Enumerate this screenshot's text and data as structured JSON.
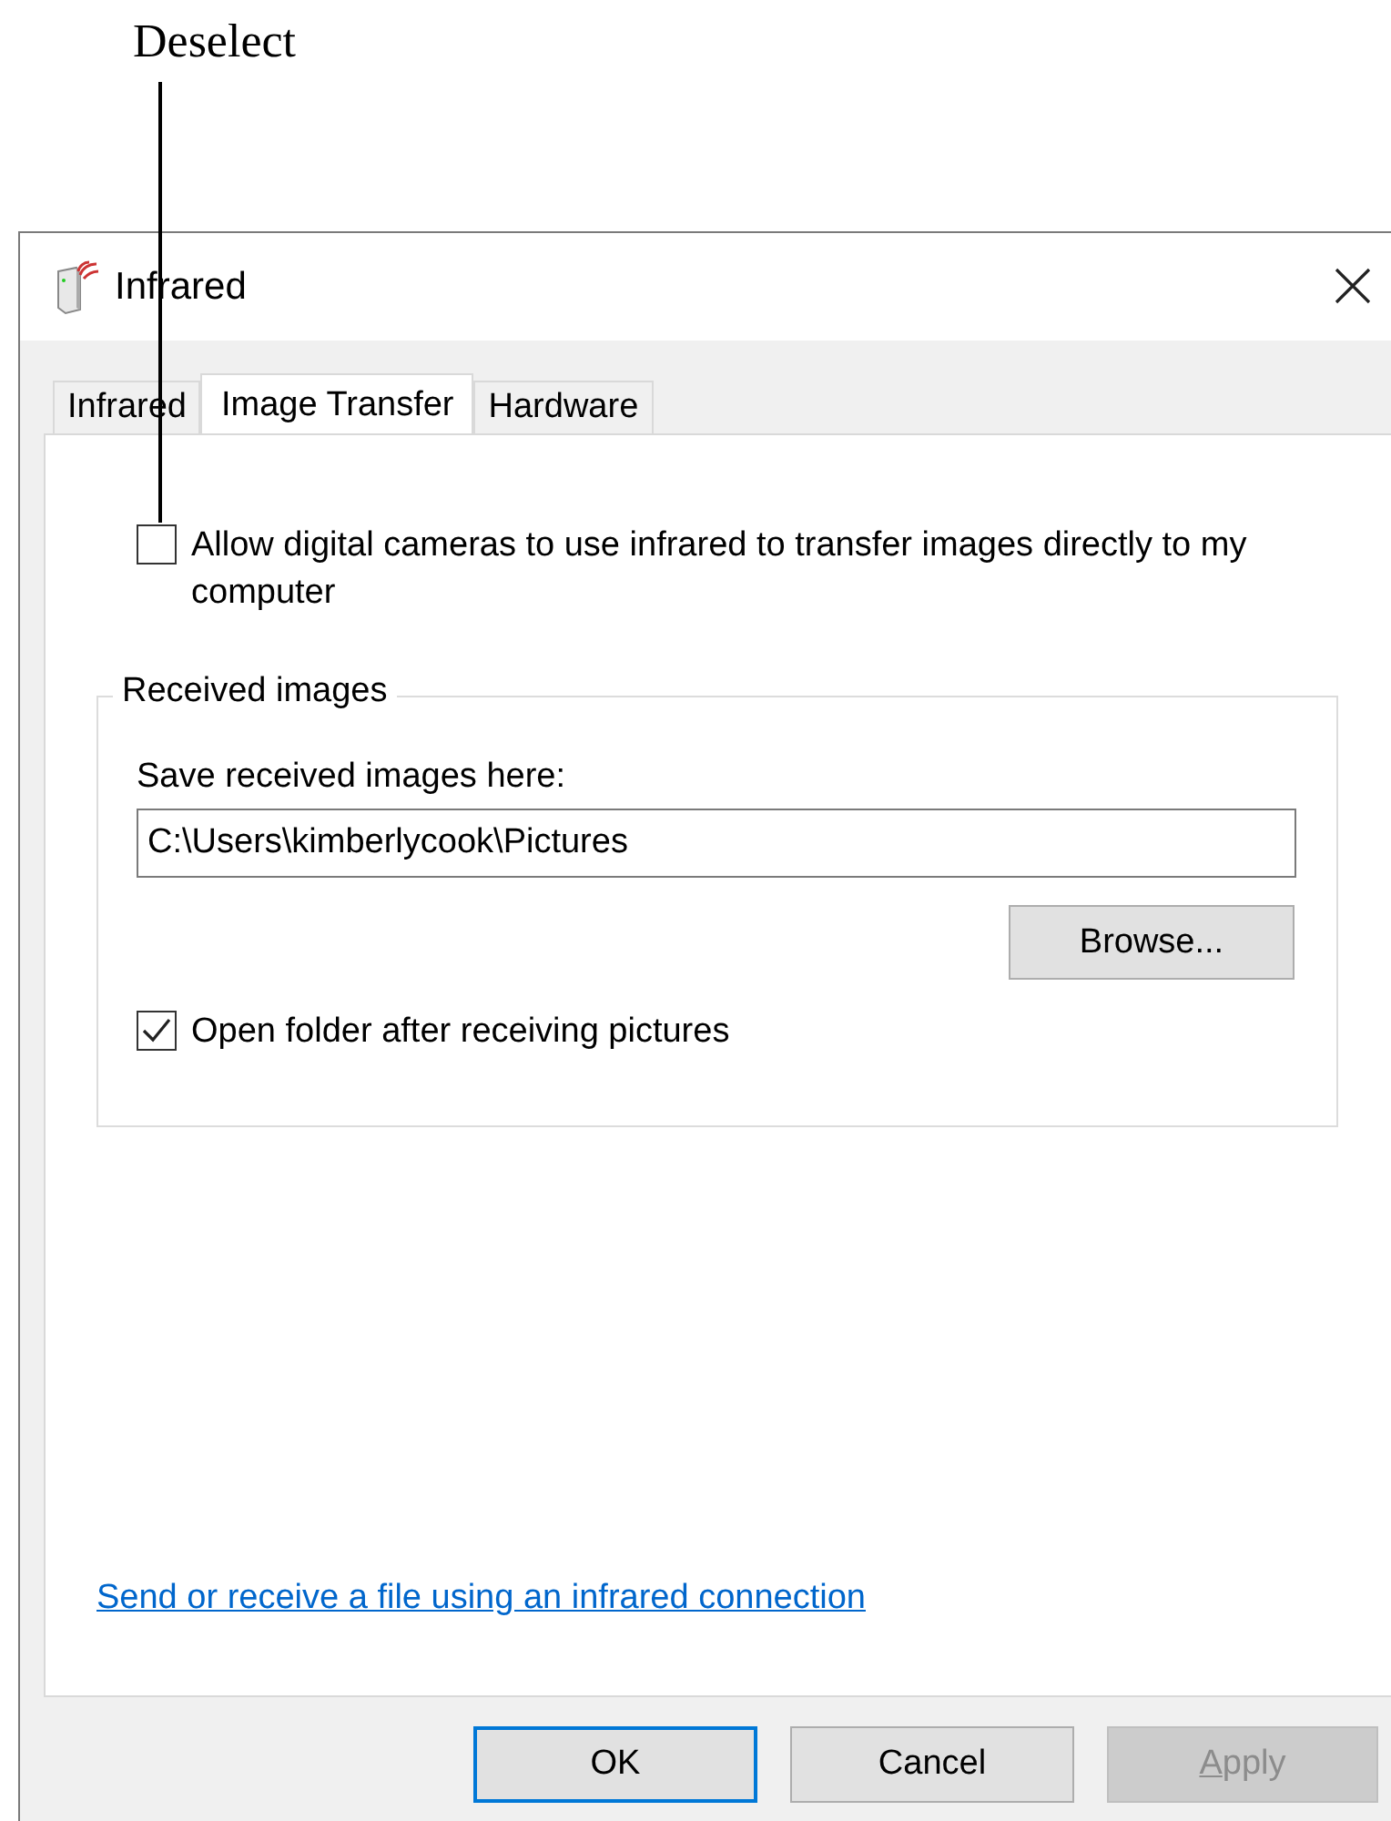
{
  "callout": {
    "label": "Deselect"
  },
  "window": {
    "title": "Infrared"
  },
  "tabs": [
    {
      "label": "Infrared",
      "selected": false
    },
    {
      "label": "Image Transfer",
      "selected": true
    },
    {
      "label": "Hardware",
      "selected": false
    }
  ],
  "transfer_option": {
    "label": "Allow digital cameras to use infrared to transfer images directly to my computer",
    "checked": false
  },
  "received_images": {
    "title": "Received images",
    "save_label": "Save received images here:",
    "path": "C:\\Users\\kimberlycook\\Pictures",
    "browse": "Browse...",
    "open_folder": {
      "label": "Open folder after receiving pictures",
      "checked": true
    }
  },
  "link": "Send or receive a file using an infrared connection",
  "buttons": [
    {
      "label": "OK",
      "default": true,
      "disabled": false
    },
    {
      "label": "Cancel",
      "default": false,
      "disabled": false
    },
    {
      "label": "Apply",
      "default": false,
      "disabled": true
    }
  ]
}
